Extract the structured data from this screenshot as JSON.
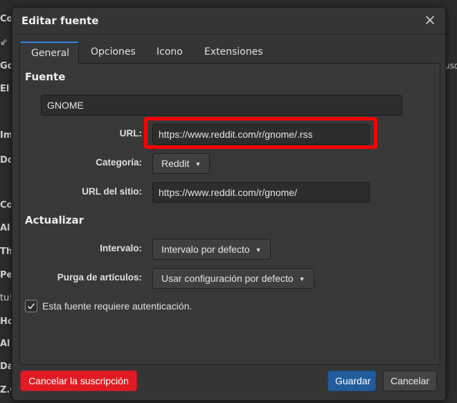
{
  "background_items": [
    {
      "text": "Co"
    },
    {
      "text": "⇙"
    },
    {
      "text": "Go"
    },
    {
      "text": "El"
    },
    {
      "text": "Im"
    },
    {
      "text": "Do"
    },
    {
      "text": "Co"
    },
    {
      "text": "Al"
    },
    {
      "text": "Th"
    },
    {
      "text": "Pe"
    },
    {
      "text": "tu!"
    },
    {
      "text": "Ho"
    },
    {
      "text": "Al"
    },
    {
      "text": "Da"
    },
    {
      "text": "Z.C"
    }
  ],
  "background_right_text": "uso",
  "dialog": {
    "title": "Editar fuente",
    "tabs": [
      {
        "label": "General",
        "active": true
      },
      {
        "label": "Opciones",
        "active": false
      },
      {
        "label": "Icono",
        "active": false
      },
      {
        "label": "Extensiones",
        "active": false
      }
    ],
    "sections": {
      "fuente": "Fuente",
      "actualizar": "Actualizar"
    },
    "feed_name": "GNOME",
    "url": {
      "label": "URL:",
      "value": "https://www.reddit.com/r/gnome/.rss"
    },
    "categoria": {
      "label": "Categoría:",
      "value": "Reddit"
    },
    "site_url": {
      "label": "URL del sitio:",
      "value": "https://www.reddit.com/r/gnome/"
    },
    "intervalo": {
      "label": "Intervalo:",
      "value": "Intervalo por defecto"
    },
    "purga": {
      "label": "Purga de artículos:",
      "value": "Usar configuración por defecto"
    },
    "auth_checkbox": {
      "label": "Esta fuente requiere autenticación.",
      "checked": true
    },
    "buttons": {
      "unsubscribe": "Cancelar la suscripción",
      "save": "Guardar",
      "cancel": "Cancelar"
    }
  },
  "colors": {
    "accent": "#3584e4",
    "danger": "#e01b24",
    "primary_button": "#215d9c",
    "highlight_box": "#ff0000"
  },
  "icons": {
    "close": "close-icon",
    "dropdown": "chevron-down-icon",
    "check": "checkmark-icon"
  }
}
